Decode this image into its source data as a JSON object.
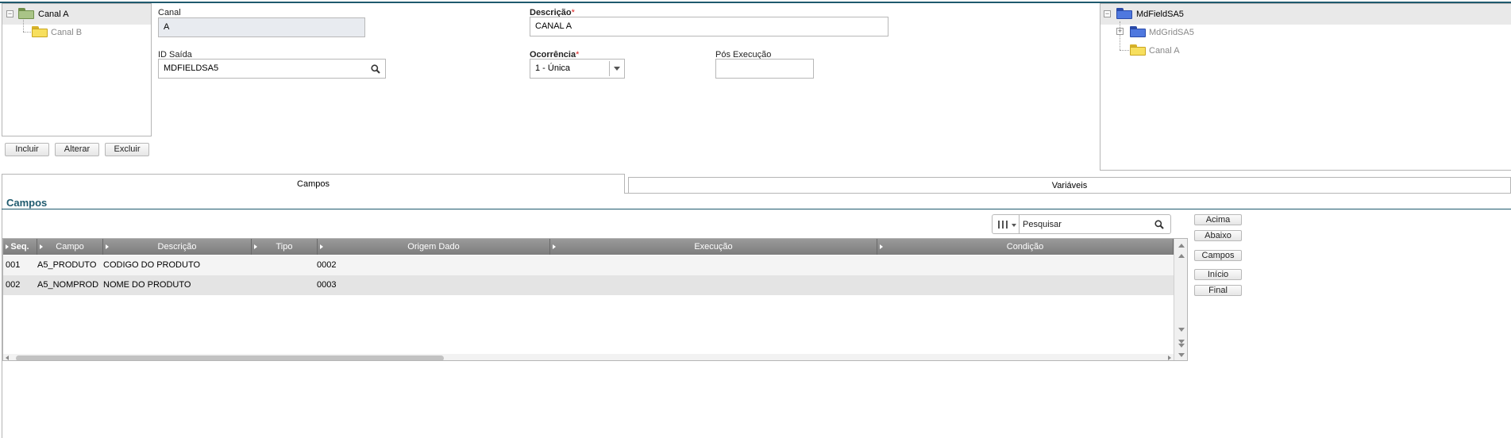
{
  "left_tree": {
    "items": [
      {
        "label": "Canal A",
        "icon": "folder-open-icon",
        "selected": true
      },
      {
        "label": "Canal B",
        "icon": "folder-icon",
        "selected": false
      }
    ]
  },
  "left_buttons": {
    "add": "Incluir",
    "edit": "Alterar",
    "delete": "Excluir"
  },
  "form": {
    "canal": {
      "label": "Canal",
      "value": "A"
    },
    "descricao": {
      "label": "Descrição",
      "required_mark": "*",
      "value": "CANAL A"
    },
    "id_saida": {
      "label": "ID Saída",
      "value": "MDFIELDSA5"
    },
    "ocorrencia": {
      "label": "Ocorrência",
      "required_mark": "*",
      "value": "1 - Única"
    },
    "pos_execucao": {
      "label": "Pós Execução",
      "value": ""
    }
  },
  "right_tree": {
    "items": [
      {
        "label": "MdFieldSA5",
        "icon": "folder-open-icon",
        "selected": true
      },
      {
        "label": "MdGridSA5",
        "icon": "folder-icon",
        "selected": false
      },
      {
        "label": "Canal A",
        "icon": "folder-icon",
        "selected": false
      }
    ]
  },
  "tabs": [
    {
      "label": "Campos",
      "active": true
    },
    {
      "label": "Variáveis",
      "active": false
    }
  ],
  "section_title": "Campos",
  "search": {
    "placeholder": "Pesquisar"
  },
  "table": {
    "columns": [
      "Seq.",
      "Campo",
      "Descrição",
      "Tipo",
      "Origem Dado",
      "Execução",
      "Condição"
    ],
    "rows": [
      {
        "seq": "001",
        "campo": "A5_PRODUTO",
        "descricao": "CODIGO DO PRODUTO",
        "tipo": "",
        "origem": "0002",
        "execucao": "",
        "condicao": ""
      },
      {
        "seq": "002",
        "campo": "A5_NOMPROD",
        "descricao": "NOME DO PRODUTO",
        "tipo": "",
        "origem": "0003",
        "execucao": "",
        "condicao": ""
      }
    ]
  },
  "side_buttons": {
    "up": "Acima",
    "down": "Abaixo",
    "fields": "Campos",
    "start": "Início",
    "end": "Final"
  },
  "colors": {
    "accent": "#1f5a6e",
    "header_grey": "#8a8a8a",
    "required": "#dd2222"
  }
}
